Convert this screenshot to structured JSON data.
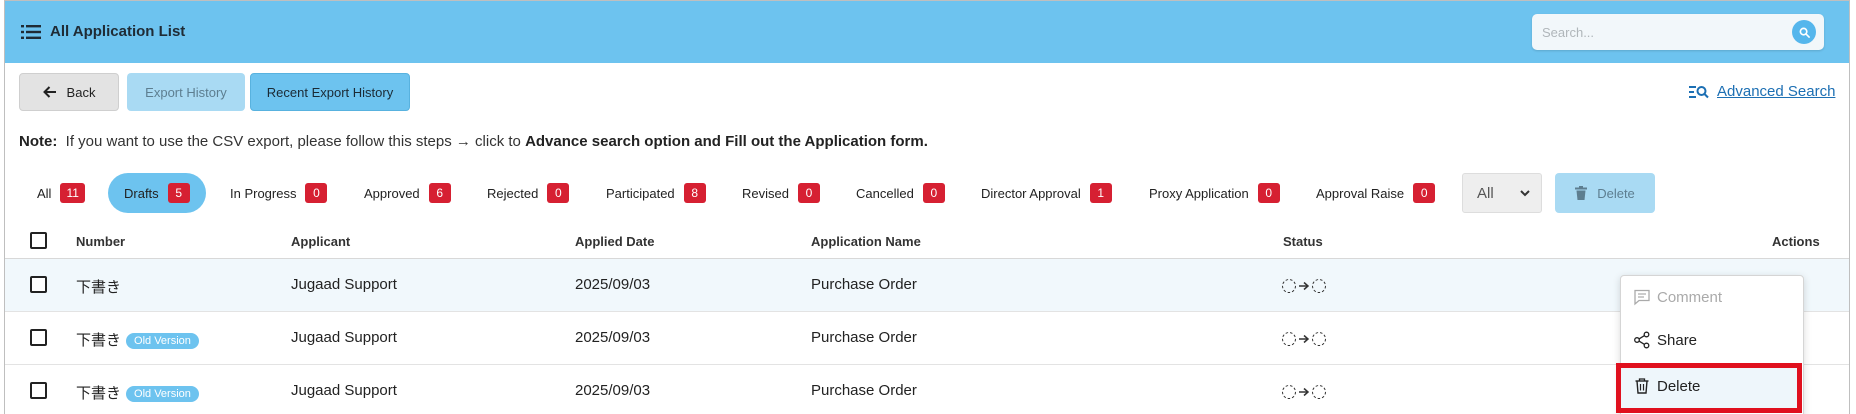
{
  "header": {
    "title": "All Application List",
    "search_placeholder": "Search...",
    "bg_color": "#6dc3ef"
  },
  "toolbar": {
    "back_label": "Back",
    "export_history_label": "Export History",
    "recent_export_label": "Recent Export History",
    "advanced_search_label": "Advanced Search"
  },
  "note": {
    "prefix": "Note:",
    "text": "If you want to use the CSV export, please follow this steps → click to",
    "bold": "Advance search option and Fill out the Application form."
  },
  "filters": [
    {
      "label": "All",
      "count": "11"
    },
    {
      "label": "Drafts",
      "count": "5",
      "active": true
    },
    {
      "label": "In Progress",
      "count": "0"
    },
    {
      "label": "Approved",
      "count": "6"
    },
    {
      "label": "Rejected",
      "count": "0"
    },
    {
      "label": "Participated",
      "count": "8"
    },
    {
      "label": "Revised",
      "count": "0"
    },
    {
      "label": "Cancelled",
      "count": "0"
    },
    {
      "label": "Director Approval",
      "count": "1"
    },
    {
      "label": "Proxy Application",
      "count": "0"
    },
    {
      "label": "Approval Raise",
      "count": "0"
    }
  ],
  "select": {
    "value": "All"
  },
  "bulk_delete_label": "Delete",
  "table": {
    "columns": [
      "Number",
      "Applicant",
      "Applied Date",
      "Application Name",
      "Status",
      "Actions"
    ],
    "rows": [
      {
        "number": "下書き",
        "tag": "",
        "applicant": "Jugaad Support",
        "date": "2025/09/03",
        "name": "Purchase Order"
      },
      {
        "number": "下書き",
        "tag": "Old Version",
        "applicant": "Jugaad Support",
        "date": "2025/09/03",
        "name": "Purchase Order"
      },
      {
        "number": "下書き",
        "tag": "Old Version",
        "applicant": "Jugaad Support",
        "date": "2025/09/03",
        "name": "Purchase Order"
      }
    ]
  },
  "context_menu": {
    "comment": "Comment",
    "share": "Share",
    "delete": "Delete"
  }
}
